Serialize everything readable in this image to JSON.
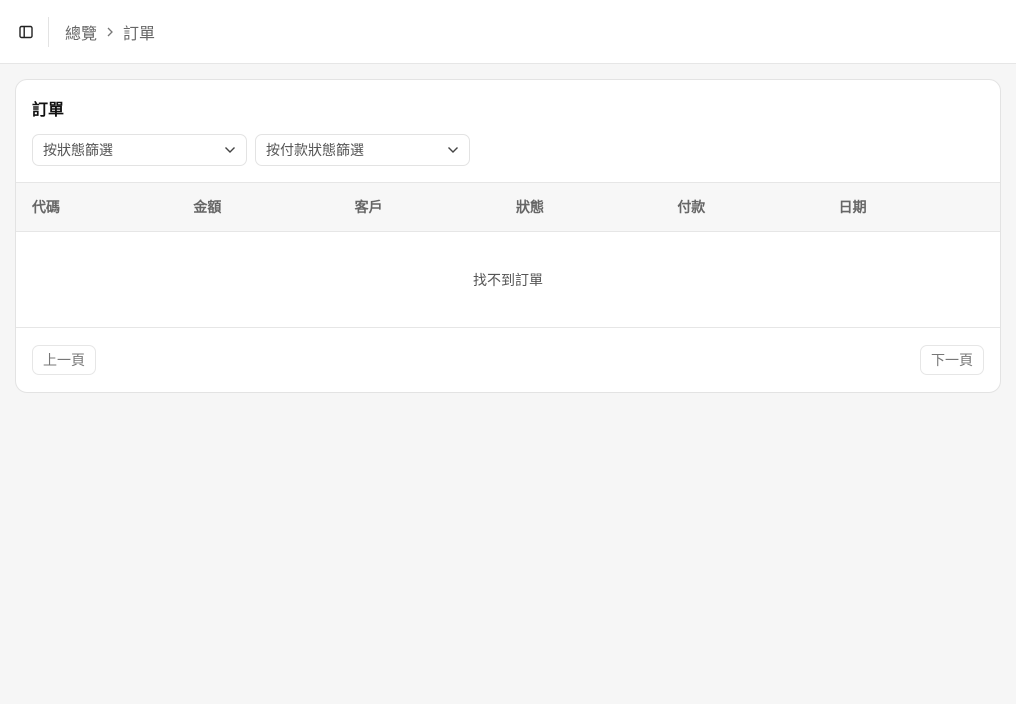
{
  "header": {
    "sidebar_toggle_icon": "sidebar-panel-icon",
    "breadcrumb": [
      {
        "label": "總覽"
      },
      {
        "label": "訂單"
      }
    ],
    "separator_icon": "chevron-right-icon"
  },
  "orders": {
    "title": "訂單",
    "filters": [
      {
        "label": "按狀態篩選",
        "icon": "chevron-down-icon"
      },
      {
        "label": "按付款狀態篩選",
        "icon": "chevron-down-icon"
      }
    ],
    "columns": [
      "代碼",
      "金額",
      "客戶",
      "狀態",
      "付款",
      "日期"
    ],
    "rows": [],
    "empty_message": "找不到訂單",
    "pagination": {
      "prev_label": "上一頁",
      "next_label": "下一頁"
    }
  }
}
